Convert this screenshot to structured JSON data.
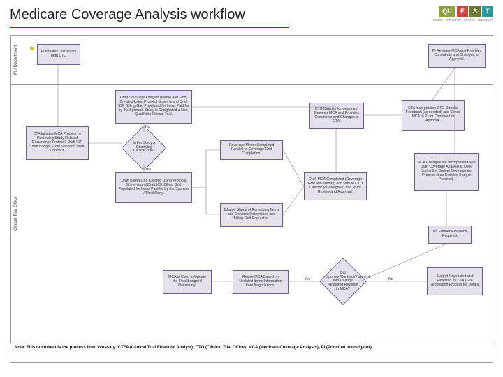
{
  "title": "Medicare Coverage Analysis workflow",
  "logo": {
    "parts": [
      "QU",
      "E",
      "S",
      "T"
    ],
    "tagline": "quality · efficiency · service · teamwork"
  },
  "lanes": {
    "lane1": "PI / Department",
    "lane2": "Clinical Trial Office"
  },
  "note": "Note: This document is the process flow. Glossary: CTFA (Clinical Trial Financial Analyst); CTO (Clinical Trial Office); MCA (Medicare Coverage Analysis); PI (Principal Investigator)",
  "nodes": {
    "pi_initiate": "PI Initiates Discussion With CTO",
    "pi_review": "PI Reviews MCA and Provides Comments and Changes, or Approval.",
    "cta_init": "CTA Initiates MCA Process by Reviewing Study Related Documents: Protocol, Draft ICF, Draft Budget From Sponsor, Draft Contract.",
    "is_qualifying": "Is the Study a Qualifying Clinical Trial?",
    "draft_coverage": "Draft Coverage Analysis (Memo and Grid) Created Using Protocol Schema and Draft ICF. Billing Grid Populated for Items Paid for by the Sponsor. Study is Designated a Non-Qualifying Clinical Trial.",
    "draft_billing": "Draft Billing Grid Created Using Protocol Schema and Draft ICF. Billing Grid Populated for Items Paid for by the Sponsor / Third Party.",
    "coverage_memo": "Coverage Memo Completed Parallel to Coverage Grid Completion.",
    "billable_status": "Billable Status of Remaining Items and Services Determined and Billing Grid Populated.",
    "draft_mca": "Draft MCA Completed (Coverage Grid and Memo), and sent to CTO Director (or designee) and PI for Review and Approval.",
    "cto_review": "CTO Director (or designee) Reviews MCA and Provides Comments and Changes to CTA.",
    "cta_incorporate": "CTA Incorporates CTO Director Feedback (as needed) and Sends MCA to PI for Comment or Approval.",
    "mca_changes": "MCA Changes are Incorporated and Draft Coverage Analysis is Used During the Budget Development Process (See Detailed Budget Process).",
    "no_revisions": "No Further Revisions Required.",
    "did_sponsor": "Did Sponsor/Contract/Payment Info Change Requiring Revision to MCA?",
    "revise_mca": "Revise MCA Based on Updated Items Information from Negotiations.",
    "mca_update": "MCA is Used to Update the Final Budget if Necessary.",
    "budget_neg": "Budget Negotiated and Finalized by CTA (See Negotiation Process for Detail)."
  },
  "edges": {
    "no": "No",
    "yes": "Yes"
  }
}
